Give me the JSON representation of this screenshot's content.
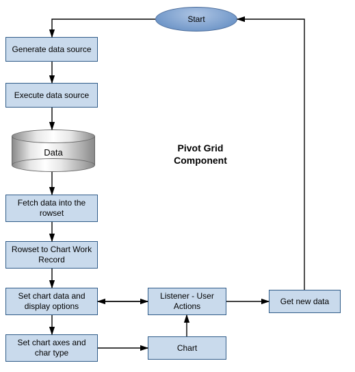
{
  "title_line1": "Pivot Grid",
  "title_line2": "Component",
  "nodes": {
    "start": "Start",
    "generate": "Generate data source",
    "execute": "Execute data source",
    "data": "Data",
    "fetch": "Fetch data into the rowset",
    "rowset": "Rowset to Chart Work Record",
    "setdata": "Set chart data and display options",
    "setaxes": "Set chart axes and char type",
    "chart": "Chart",
    "listener": "Listener - User Actions",
    "getnew": "Get new data"
  },
  "colors": {
    "node_fill": "#c9daec",
    "node_border": "#2f5b88",
    "arrow": "#000000"
  }
}
